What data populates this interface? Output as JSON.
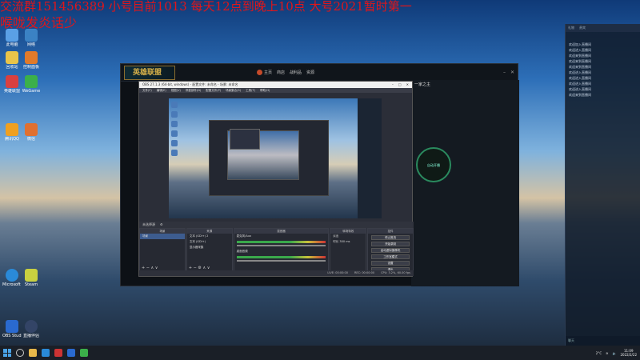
{
  "overlay": {
    "line1": "交流群151456389 小号目前1013 每天12点到晚上10点 大号2021暂时第一",
    "line2": "喉咙发炎话少"
  },
  "game_client": {
    "logo_text": "英雄联盟",
    "nav": [
      "主页",
      "商店",
      "战利品",
      "资源"
    ]
  },
  "obs": {
    "title": "OBS 27.1.3 (64-bit, windows) - 配置文件: 未命名 - 场景: 未命名",
    "menu": [
      "文件(F)",
      "编辑(E)",
      "视图(V)",
      "停靠部件(D)",
      "配置文件(P)",
      "场景集合(S)",
      "工具(T)",
      "帮助(H)"
    ],
    "source_toolbar": "未选择源",
    "docks": {
      "scenes": {
        "header": "场景",
        "items": [
          "场景"
        ]
      },
      "sources": {
        "header": "来源",
        "items": [
          "文本 (GDI+) 2",
          "文本 (GDI+)",
          "显示器采集"
        ]
      },
      "mixer": {
        "header": "混音器",
        "channels": [
          "麦克风/Aux",
          "桌面音频"
        ]
      },
      "transitions": {
        "header": "转场特效",
        "type": "淡出",
        "duration_label": "时长",
        "duration": "300 ms"
      },
      "controls": {
        "header": "控件",
        "buttons": [
          "停止推流",
          "开始录制",
          "启动虚拟摄像机",
          "工作室模式",
          "设置",
          "退出"
        ]
      }
    },
    "status": [
      "LIVE: 00:00:00",
      "REC: 00:00:00",
      "CPU: 3.2%, 60.00 fps"
    ]
  },
  "chat_pane": {
    "title": "一家之主",
    "circle_label": "自动开播"
  },
  "right_panel": {
    "tabs": [
      "礼物",
      "贵宾"
    ],
    "messages": [
      "欢迎加入直播间",
      "欢迎进入直播间",
      "欢迎来到直播间",
      "欢迎来到直播间",
      "欢迎来到直播间",
      "欢迎进入直播间",
      "欢迎进入直播间",
      "欢迎进入直播间",
      "欢迎进入直播间",
      "欢迎来到直播间"
    ],
    "bottom": "聊天"
  },
  "desktop_icons": [
    "此电脑",
    "网络",
    "回收站",
    "控制面板",
    "英雄联盟",
    "WeGame",
    "腾讯QQ",
    "微信",
    "Microsoft Edge",
    "Steam",
    "OBS Studio",
    "直播伴侣"
  ],
  "taskbar": {
    "time": "11:09",
    "date": "2022/2/22",
    "temperature": "2°C"
  },
  "colors": {
    "overlay_red": "#e0161a",
    "lol_gold": "#d9b24a",
    "obs_bg": "#2b2e38"
  }
}
